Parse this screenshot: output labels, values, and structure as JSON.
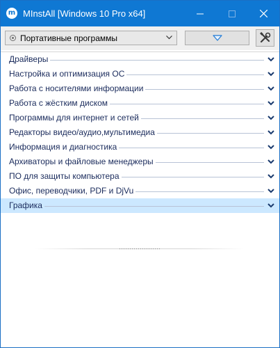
{
  "window": {
    "title": "MInstAll [Windows 10 Pro x64]",
    "app_icon_glyph": "m",
    "accent_color": "#0f78d3"
  },
  "toolbar": {
    "profile_select_value": "Портативные программы",
    "expand_icon": "chevron-down-icon",
    "tools_icon": "tools-icon"
  },
  "categories": [
    {
      "label": "Драйверы",
      "selected": false
    },
    {
      "label": "Настройка и оптимизация ОС",
      "selected": false
    },
    {
      "label": "Работа с носителями информации",
      "selected": false
    },
    {
      "label": "Работа с жёстким диском",
      "selected": false
    },
    {
      "label": "Программы для интернет и сетей",
      "selected": false
    },
    {
      "label": "Редакторы видео/аудио,мультимедиа",
      "selected": false
    },
    {
      "label": "Информация и диагностика",
      "selected": false
    },
    {
      "label": "Архиваторы и файловые менеджеры",
      "selected": false
    },
    {
      "label": "ПО для защиты компьютера",
      "selected": false
    },
    {
      "label": "Офис, переводчики, PDF и DjVu",
      "selected": false
    },
    {
      "label": "Графика",
      "selected": true
    }
  ]
}
